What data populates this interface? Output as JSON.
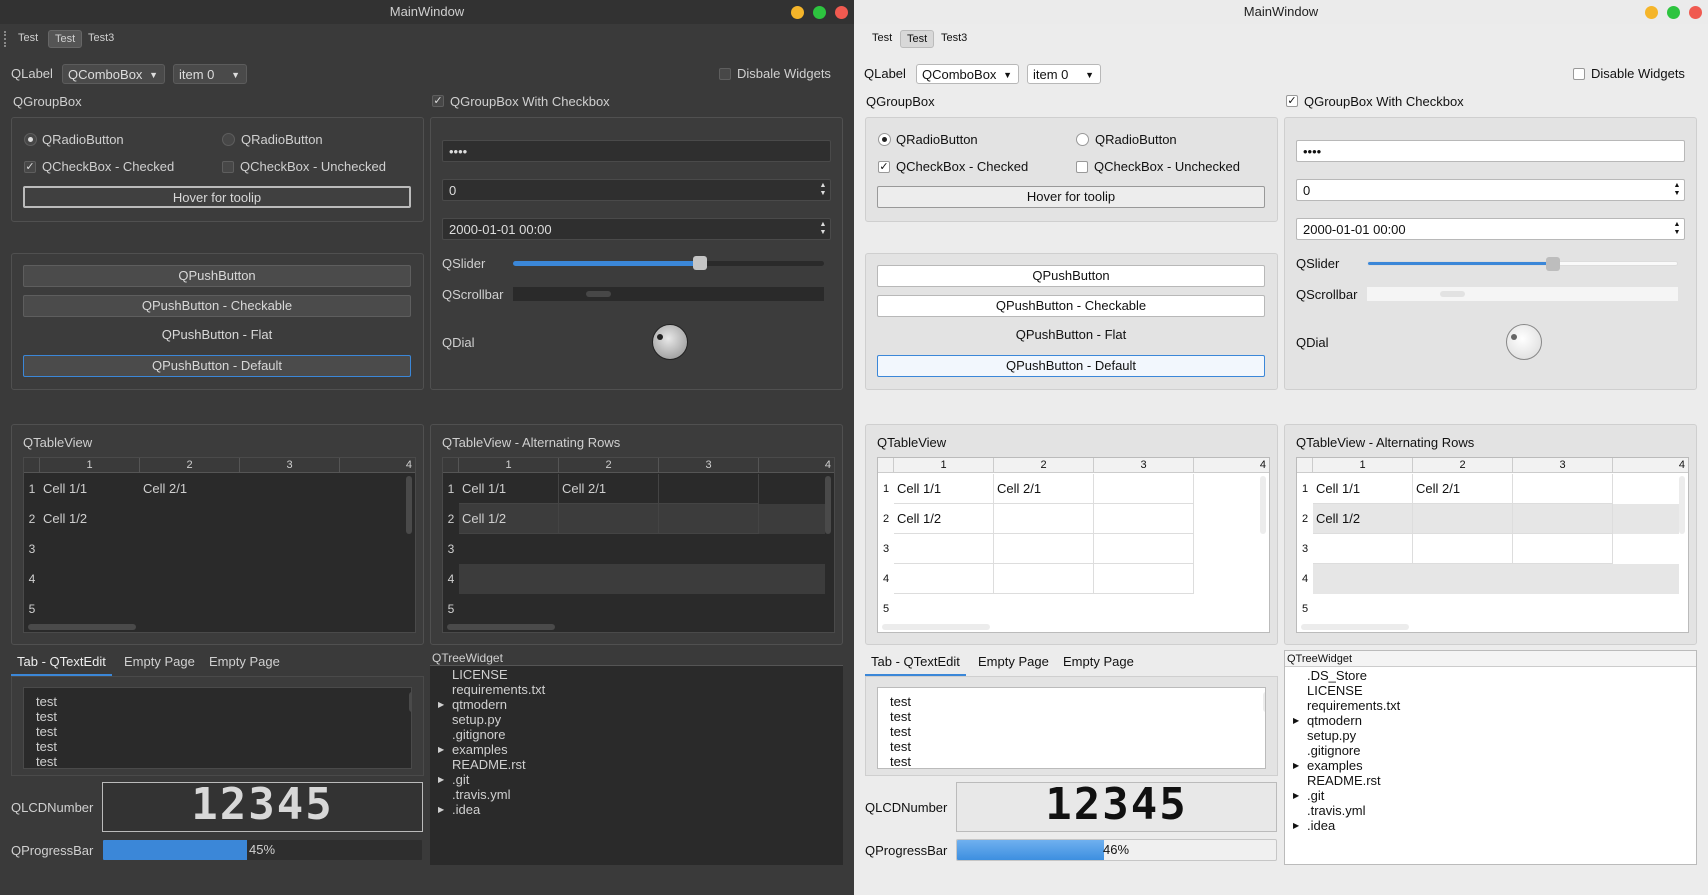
{
  "window": {
    "title": "MainWindow"
  },
  "toolbar": {
    "items": [
      "Test",
      "Test",
      "Test3"
    ]
  },
  "top": {
    "label": "QLabel",
    "combo1": "QComboBox",
    "combo2": "item 0",
    "disable_dark": "Disbale Widgets",
    "disable_light": "Disable Widgets"
  },
  "groupbox": {
    "title": "QGroupBox",
    "radio1": "QRadioButton",
    "radio2": "QRadioButton",
    "check_checked": "QCheckBox - Checked",
    "check_unchecked": "QCheckBox - Unchecked",
    "tooltip_button": "Hover for toolip"
  },
  "buttons": {
    "push": "QPushButton",
    "checkable": "QPushButton - Checkable",
    "flat": "QPushButton - Flat",
    "default": "QPushButton - Default"
  },
  "checkgroup": {
    "title": "QGroupBox With Checkbox",
    "password": "••••",
    "spin_value": "0",
    "datetime": "2000-01-01 00:00",
    "slider_label": "QSlider",
    "slider_value": 0.6,
    "scrollbar_label": "QScrollbar",
    "dial_label": "QDial"
  },
  "table": {
    "title": "QTableView",
    "title_alt": "QTableView - Alternating Rows",
    "columns": [
      "1",
      "2",
      "3",
      "4"
    ],
    "rows": [
      "1",
      "2",
      "3",
      "4",
      "5"
    ],
    "cells": [
      [
        "Cell 1/1",
        "Cell 2/1"
      ],
      [
        "Cell 1/2",
        ""
      ]
    ]
  },
  "tabs": {
    "items": [
      "Tab - QTextEdit",
      "Empty Page",
      "Empty Page"
    ],
    "text_lines": [
      "test",
      "test",
      "test",
      "test",
      "test"
    ]
  },
  "tree": {
    "title": "QTreeWidget",
    "items_dark": [
      {
        "label": "LICENSE",
        "expandable": false
      },
      {
        "label": "requirements.txt",
        "expandable": false
      },
      {
        "label": "qtmodern",
        "expandable": true
      },
      {
        "label": "setup.py",
        "expandable": false
      },
      {
        "label": ".gitignore",
        "expandable": false
      },
      {
        "label": "examples",
        "expandable": true
      },
      {
        "label": "README.rst",
        "expandable": false
      },
      {
        "label": ".git",
        "expandable": true
      },
      {
        "label": ".travis.yml",
        "expandable": false
      },
      {
        "label": ".idea",
        "expandable": true
      }
    ],
    "items_light": [
      {
        "label": ".DS_Store",
        "expandable": false
      },
      {
        "label": "LICENSE",
        "expandable": false
      },
      {
        "label": "requirements.txt",
        "expandable": false
      },
      {
        "label": "qtmodern",
        "expandable": true
      },
      {
        "label": "setup.py",
        "expandable": false
      },
      {
        "label": ".gitignore",
        "expandable": false
      },
      {
        "label": "examples",
        "expandable": true
      },
      {
        "label": "README.rst",
        "expandable": false
      },
      {
        "label": ".git",
        "expandable": true
      },
      {
        "label": ".travis.yml",
        "expandable": false
      },
      {
        "label": ".idea",
        "expandable": true
      }
    ]
  },
  "bottom": {
    "lcd_label": "QLCDNumber",
    "lcd_value": "12345",
    "progress_label": "QProgressBar",
    "progress_dark": 0.45,
    "progress_dark_text": "45%",
    "progress_light": 0.46,
    "progress_light_text": "46%"
  },
  "colors": {
    "accent": "#3b87d8",
    "dark_bg": "#3a3a3a",
    "light_bg": "#ececec"
  },
  "icons": {
    "check": "check-icon",
    "arrow": "chevron-down-icon",
    "expand": "expand-arrow-icon"
  }
}
